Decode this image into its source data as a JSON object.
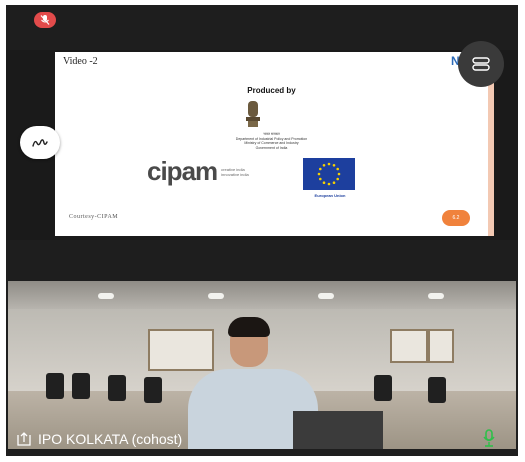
{
  "slide": {
    "title": "Video -2",
    "brand": "N",
    "heading": "Produced by",
    "dept_lines": [
      "भारत सरकार",
      "Department of Industrial Policy and Promotion",
      "Ministry of Commerce and Industry",
      "Government of India"
    ],
    "cipam_word": "cipam",
    "cipam_sub_1": "creative india",
    "cipam_sub_2": "innovative india",
    "eu_label": "European Union",
    "courtesy": "Courtesy-CIPAM",
    "page_number": "6.2"
  },
  "participant": {
    "name": "IPO KOLKATA (cohost)"
  },
  "icons": {
    "mute": "mic-muted-icon",
    "annotate": "annotate-pen-icon",
    "menu": "menu-icon",
    "share": "share-icon",
    "mic": "mic-active-icon"
  },
  "colors": {
    "mute_badge": "#e24b4b",
    "mic_active": "#2fbf4a",
    "page_badge": "#f0823c"
  }
}
